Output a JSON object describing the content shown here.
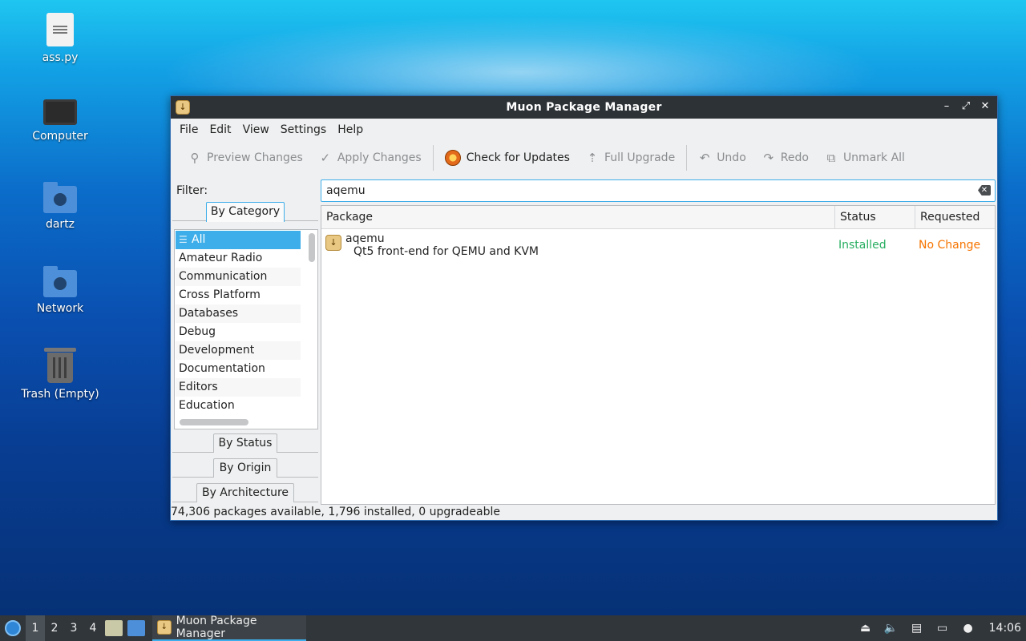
{
  "desktop": {
    "icons": [
      {
        "label": "ass.py",
        "icon": "python-file-icon"
      },
      {
        "label": "Computer",
        "icon": "computer-icon"
      },
      {
        "label": "dartz",
        "icon": "home-folder-icon"
      },
      {
        "label": "Network",
        "icon": "network-folder-icon"
      },
      {
        "label": "Trash (Empty)",
        "icon": "trash-icon"
      }
    ]
  },
  "window": {
    "title": "Muon Package Manager",
    "controls": {
      "minimize": "–",
      "maximize": "⤢",
      "close": "✕"
    },
    "menu": [
      "File",
      "Edit",
      "View",
      "Settings",
      "Help"
    ],
    "toolbar": {
      "preview": "Preview Changes",
      "apply": "Apply Changes",
      "check": "Check for Updates",
      "upgrade": "Full Upgrade",
      "undo": "Undo",
      "redo": "Redo",
      "unmark": "Unmark All"
    },
    "filter": {
      "label": "Filter:",
      "tabs": {
        "category": "By Category",
        "status": "By Status",
        "origin": "By Origin",
        "architecture": "By Architecture"
      },
      "categories": [
        "All",
        "Amateur Radio",
        "Communication",
        "Cross Platform",
        "Databases",
        "Debug",
        "Development",
        "Documentation",
        "Editors",
        "Education"
      ],
      "selected": "All"
    },
    "search": {
      "value": "aqemu"
    },
    "table": {
      "headers": {
        "package": "Package",
        "status": "Status",
        "requested": "Requested"
      },
      "rows": [
        {
          "name": "aqemu",
          "description": "Qt5 front-end for QEMU and KVM",
          "status": "Installed",
          "requested": "No Change"
        }
      ]
    },
    "statusbar": "74,306 packages available, 1,796 installed, 0 upgradeable"
  },
  "taskbar": {
    "desktops": [
      "1",
      "2",
      "3",
      "4"
    ],
    "active_desktop": "1",
    "task": "Muon Package Manager",
    "clock": "14:06"
  },
  "colors": {
    "accent": "#3daee9",
    "installed": "#27ae60",
    "no_change": "#f67400",
    "titlebar": "#2d3237",
    "taskbar": "#31363b"
  }
}
